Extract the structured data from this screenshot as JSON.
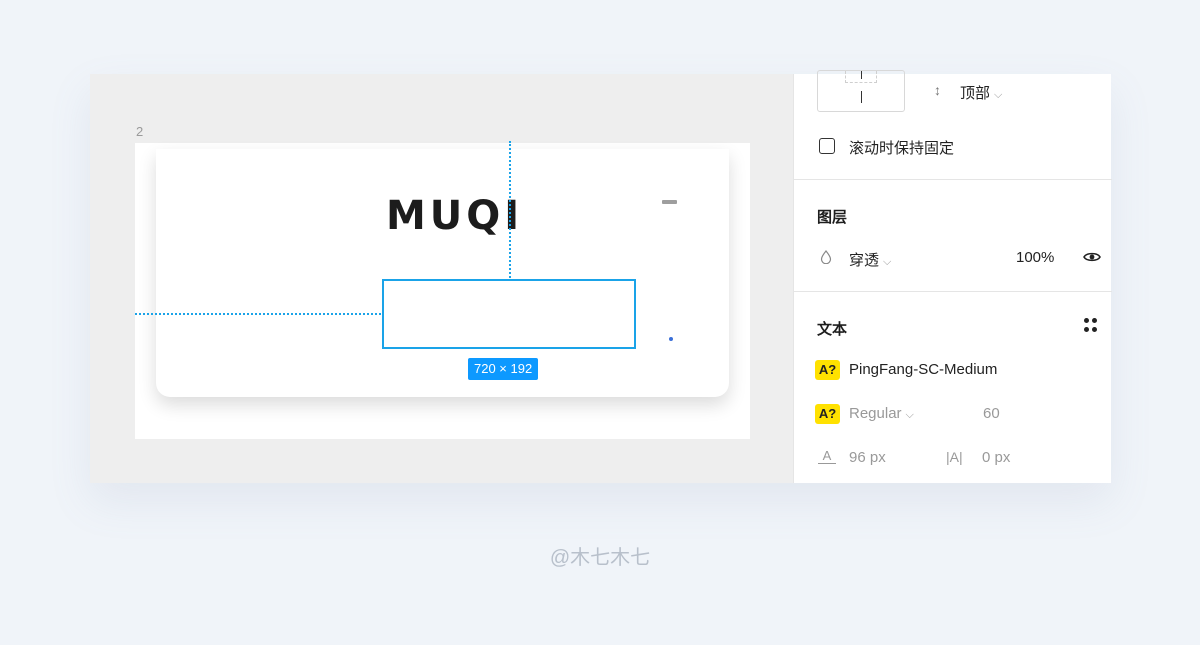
{
  "canvas": {
    "frame_label": "2",
    "logo_text": "MUQI",
    "size_badge": "720 × 192"
  },
  "panel": {
    "constraints": {
      "vertical_value": "顶部",
      "scroll_fixed_label": "滚动时保持固定"
    },
    "layer": {
      "title": "图层",
      "blend_mode": "穿透",
      "opacity": "100%"
    },
    "text": {
      "title": "文本",
      "font_family": "PingFang-SC-Medium",
      "font_weight": "Regular",
      "font_size": "60",
      "line_height": "96 px",
      "letter_spacing": "0 px",
      "missing_font_badge": "A?"
    }
  },
  "watermark": "@木七木七",
  "colors": {
    "selection": "#1aa3e8",
    "badge_blue": "#0d99ff",
    "missing_font_yellow": "#ffe100"
  }
}
